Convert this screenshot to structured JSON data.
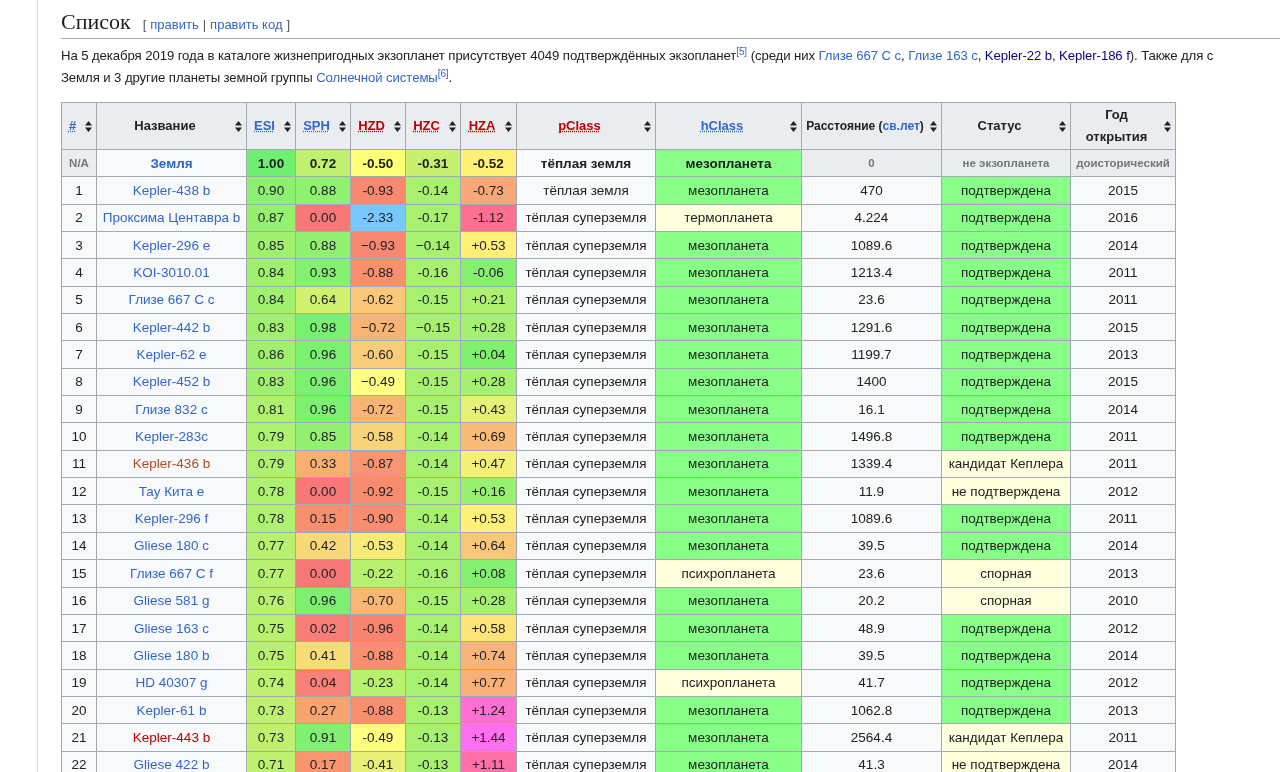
{
  "section": {
    "title": "Список",
    "edit": [
      {
        "kind": "text",
        "text": "["
      },
      {
        "kind": "link",
        "text": "править"
      },
      {
        "kind": "text",
        "text": "|"
      },
      {
        "kind": "link",
        "text": "править код"
      },
      {
        "kind": "text",
        "text": "]"
      }
    ],
    "paragraph": [
      [
        {
          "kind": "text",
          "text": "На 5 декабря 2019 года в каталоге жизнепригодных экзопланет присутствует 4049 подтверждённых экзопланет"
        },
        {
          "kind": "ref",
          "text": "[5]"
        },
        {
          "kind": "text",
          "text": " (среди них "
        },
        {
          "kind": "link",
          "text": "Глизе 667 C c",
          "color": "#3366cc"
        },
        {
          "kind": "text",
          "text": ", "
        },
        {
          "kind": "link",
          "text": "Глизе 163 c",
          "color": "#3366cc"
        },
        {
          "kind": "text",
          "text": ", "
        },
        {
          "kind": "link",
          "text": "Kepler-22 b",
          "color": "#0b0080"
        },
        {
          "kind": "text",
          "text": ", "
        },
        {
          "kind": "link",
          "text": "Kepler-186 f",
          "color": "#0b0080"
        },
        {
          "kind": "text",
          "text": "). Также для с"
        }
      ],
      [
        {
          "kind": "text",
          "text": "Земля и 3 другие планеты земной группы "
        },
        {
          "kind": "link",
          "text": "Солнечной системы",
          "color": "#3366cc"
        },
        {
          "kind": "ref",
          "text": "[6]"
        },
        {
          "kind": "text",
          "text": "."
        }
      ]
    ]
  },
  "table": {
    "columns": [
      {
        "parts": [
          {
            "kind": "link",
            "text": "#"
          }
        ]
      },
      {
        "parts": [
          {
            "kind": "text",
            "text": "Название"
          }
        ]
      },
      {
        "parts": [
          {
            "kind": "link",
            "text": "ESI"
          }
        ]
      },
      {
        "parts": [
          {
            "kind": "link",
            "text": "SPH"
          }
        ]
      },
      {
        "parts": [
          {
            "kind": "redlink",
            "text": "HZD"
          }
        ]
      },
      {
        "parts": [
          {
            "kind": "redlink",
            "text": "HZC"
          }
        ]
      },
      {
        "parts": [
          {
            "kind": "redlink",
            "text": "HZA"
          }
        ]
      },
      {
        "parts": [
          {
            "kind": "redlink",
            "text": "pClass"
          }
        ]
      },
      {
        "parts": [
          {
            "kind": "link",
            "text": "hClass"
          }
        ]
      },
      {
        "parts": [
          {
            "kind": "text",
            "text": "Расстояние ("
          },
          {
            "kind": "link",
            "text": "св.лет"
          },
          {
            "kind": "text",
            "text": ")"
          }
        ]
      },
      {
        "parts": [
          {
            "kind": "text",
            "text": "Статус"
          }
        ]
      },
      {
        "parts": [
          {
            "kind": "text",
            "text": "Год открытия"
          }
        ]
      }
    ],
    "rows": [
      {
        "kind": "reference",
        "cells": [
          {
            "text": "N/A",
            "color": "#eaecf0",
            "muted": true
          },
          {
            "text": "Земля",
            "color": "#3366cc"
          },
          {
            "text": "1.00",
            "color": "#70f070"
          },
          {
            "text": "0.72",
            "color": "#c0f070"
          },
          {
            "text": "-0.50",
            "color": "#ffff78"
          },
          {
            "text": "-0.31",
            "color": "#c8f070"
          },
          {
            "text": "-0.52",
            "color": "#fff078"
          },
          {
            "text": "тёплая земля"
          },
          {
            "text": "мезопланета",
            "color": "#88ff88"
          },
          {
            "text": "0",
            "color": "#eaecf0",
            "muted": true
          },
          {
            "text": "не экзопланета",
            "color": "#eaecf0",
            "muted": true
          },
          {
            "text": "доисторический",
            "color": "#eaecf0",
            "muted": true
          }
        ]
      },
      {
        "kind": "planet",
        "cells": [
          {
            "text": "1"
          },
          {
            "text": "Kepler-438 b",
            "color": "#3366cc"
          },
          {
            "text": "0.90",
            "color": "#8cf070"
          },
          {
            "text": "0.88",
            "color": "#90f070"
          },
          {
            "text": "-0.93",
            "color": "#f88870"
          },
          {
            "text": "-0.14",
            "color": "#a8f070"
          },
          {
            "text": "-0.73",
            "color": "#f8a878"
          },
          {
            "text": "тёплая земля"
          },
          {
            "text": "мезопланета",
            "color": "#88ff88"
          },
          {
            "text": "470"
          },
          {
            "text": "подтверждена",
            "color": "#88ff88"
          },
          {
            "text": "2015"
          }
        ]
      },
      {
        "kind": "planet",
        "cells": [
          {
            "text": "2"
          },
          {
            "text": "Проксима Центавра b",
            "color": "#3366cc"
          },
          {
            "text": "0.87",
            "color": "#96f070"
          },
          {
            "text": "0.00",
            "color": "#f87878"
          },
          {
            "text": "-2.33",
            "color": "#78c8ff"
          },
          {
            "text": "-0.17",
            "color": "#a8f070"
          },
          {
            "text": "-1.12",
            "color": "#ff6f8f"
          },
          {
            "text": "тёплая суперземля"
          },
          {
            "text": "термопланета",
            "color": "#ffffdd"
          },
          {
            "text": "4.224"
          },
          {
            "text": "подтверждена",
            "color": "#88ff88"
          },
          {
            "text": "2016"
          }
        ]
      },
      {
        "kind": "planet",
        "cells": [
          {
            "text": "3"
          },
          {
            "text": "Kepler-296 e",
            "color": "#3366cc"
          },
          {
            "text": "0.85",
            "color": "#a0f070"
          },
          {
            "text": "0.88",
            "color": "#90f070"
          },
          {
            "text": "−0.93",
            "color": "#f88870"
          },
          {
            "text": "−0.14",
            "color": "#a8f070"
          },
          {
            "text": "+0.53",
            "color": "#fff078"
          },
          {
            "text": "тёплая суперземля"
          },
          {
            "text": "мезопланета",
            "color": "#88ff88"
          },
          {
            "text": "1089.6"
          },
          {
            "text": "подтверждена",
            "color": "#88ff88"
          },
          {
            "text": "2014"
          }
        ]
      },
      {
        "kind": "planet",
        "cells": [
          {
            "text": "4"
          },
          {
            "text": "KOI-3010.01",
            "color": "#3366cc"
          },
          {
            "text": "0.84",
            "color": "#a0f070"
          },
          {
            "text": "0.93",
            "color": "#84f070"
          },
          {
            "text": "-0.88",
            "color": "#f89070"
          },
          {
            "text": "-0.16",
            "color": "#a8f070"
          },
          {
            "text": "-0.06",
            "color": "#84f070"
          },
          {
            "text": "тёплая суперземля"
          },
          {
            "text": "мезопланета",
            "color": "#88ff88"
          },
          {
            "text": "1213.4"
          },
          {
            "text": "подтверждена",
            "color": "#88ff88"
          },
          {
            "text": "2011"
          }
        ]
      },
      {
        "kind": "planet",
        "cells": [
          {
            "text": "5"
          },
          {
            "text": "Глизе 667 C c",
            "color": "#3366cc"
          },
          {
            "text": "0.84",
            "color": "#a0f070"
          },
          {
            "text": "0.64",
            "color": "#d0f070"
          },
          {
            "text": "-0.62",
            "color": "#f8c878"
          },
          {
            "text": "-0.15",
            "color": "#a8f070"
          },
          {
            "text": "+0.21",
            "color": "#acf070"
          },
          {
            "text": "тёплая суперземля"
          },
          {
            "text": "мезопланета",
            "color": "#88ff88"
          },
          {
            "text": "23.6"
          },
          {
            "text": "подтверждена",
            "color": "#88ff88"
          },
          {
            "text": "2011"
          }
        ]
      },
      {
        "kind": "planet",
        "cells": [
          {
            "text": "6"
          },
          {
            "text": "Kepler-442 b",
            "color": "#3366cc"
          },
          {
            "text": "0.83",
            "color": "#a0f070"
          },
          {
            "text": "0.98",
            "color": "#78f070"
          },
          {
            "text": "−0.72",
            "color": "#f8b474"
          },
          {
            "text": "−0.15",
            "color": "#a8f070"
          },
          {
            "text": "+0.28",
            "color": "#a4f070"
          },
          {
            "text": "тёплая суперземля"
          },
          {
            "text": "мезопланета",
            "color": "#88ff88"
          },
          {
            "text": "1291.6"
          },
          {
            "text": "подтверждена",
            "color": "#88ff88"
          },
          {
            "text": "2015"
          }
        ]
      },
      {
        "kind": "planet",
        "cells": [
          {
            "text": "7"
          },
          {
            "text": "Kepler-62 e",
            "color": "#3366cc"
          },
          {
            "text": "0.86",
            "color": "#a0f070"
          },
          {
            "text": "0.96",
            "color": "#7cf070"
          },
          {
            "text": "-0.60",
            "color": "#f8cc78"
          },
          {
            "text": "-0.15",
            "color": "#a8f070"
          },
          {
            "text": "+0.04",
            "color": "#80f070"
          },
          {
            "text": "тёплая суперземля"
          },
          {
            "text": "мезопланета",
            "color": "#88ff88"
          },
          {
            "text": "1199.7"
          },
          {
            "text": "подтверждена",
            "color": "#88ff88"
          },
          {
            "text": "2013"
          }
        ]
      },
      {
        "kind": "planet",
        "cells": [
          {
            "text": "8"
          },
          {
            "text": "Kepler-452 b",
            "color": "#3366cc"
          },
          {
            "text": "0.83",
            "color": "#a0f070"
          },
          {
            "text": "0.96",
            "color": "#7cf070"
          },
          {
            "text": "−0.49",
            "color": "#ffff80"
          },
          {
            "text": "-0.15",
            "color": "#a8f070"
          },
          {
            "text": "+0.28",
            "color": "#a4f070"
          },
          {
            "text": "тёплая суперземля"
          },
          {
            "text": "мезопланета",
            "color": "#88ff88"
          },
          {
            "text": "1400"
          },
          {
            "text": "подтверждена",
            "color": "#88ff88"
          },
          {
            "text": "2015"
          }
        ]
      },
      {
        "kind": "planet",
        "cells": [
          {
            "text": "9"
          },
          {
            "text": "Глизе 832 c",
            "color": "#3366cc"
          },
          {
            "text": "0.81",
            "color": "#aef070"
          },
          {
            "text": "0.96",
            "color": "#7cf070"
          },
          {
            "text": "-0.72",
            "color": "#f8b474"
          },
          {
            "text": "-0.15",
            "color": "#a8f070"
          },
          {
            "text": "+0.43",
            "color": "#e4f078"
          },
          {
            "text": "тёплая суперземля"
          },
          {
            "text": "мезопланета",
            "color": "#88ff88"
          },
          {
            "text": "16.1"
          },
          {
            "text": "подтверждена",
            "color": "#88ff88"
          },
          {
            "text": "2014"
          }
        ]
      },
      {
        "kind": "planet",
        "cells": [
          {
            "text": "10"
          },
          {
            "text": "Kepler-283c",
            "color": "#3366cc"
          },
          {
            "text": "0.79",
            "color": "#aef070"
          },
          {
            "text": "0.85",
            "color": "#94f070"
          },
          {
            "text": "-0.58",
            "color": "#f8d478"
          },
          {
            "text": "-0.14",
            "color": "#a8f070"
          },
          {
            "text": "+0.69",
            "color": "#f8bc78"
          },
          {
            "text": "тёплая суперземля"
          },
          {
            "text": "мезопланета",
            "color": "#88ff88"
          },
          {
            "text": "1496.8"
          },
          {
            "text": "подтверждена",
            "color": "#88ff88"
          },
          {
            "text": "2011"
          }
        ]
      },
      {
        "kind": "planet",
        "cells": [
          {
            "text": "11"
          },
          {
            "text": "Kepler-436 b",
            "color": "#b04a20"
          },
          {
            "text": "0.79",
            "color": "#aef070"
          },
          {
            "text": "0.33",
            "color": "#f8b070"
          },
          {
            "text": "-0.87",
            "color": "#f89470"
          },
          {
            "text": "-0.14",
            "color": "#a8f070"
          },
          {
            "text": "+0.47",
            "color": "#f4f078"
          },
          {
            "text": "тёплая суперземля"
          },
          {
            "text": "мезопланета",
            "color": "#88ff88"
          },
          {
            "text": "1339.4"
          },
          {
            "text": "кандидат Кеплера",
            "color": "#ffffdd"
          },
          {
            "text": "2011"
          }
        ]
      },
      {
        "kind": "planet",
        "cells": [
          {
            "text": "12"
          },
          {
            "text": "Тау Кита e",
            "color": "#3366cc"
          },
          {
            "text": "0.78",
            "color": "#aef070"
          },
          {
            "text": "0.00",
            "color": "#f87878"
          },
          {
            "text": "-0.92",
            "color": "#f88c70"
          },
          {
            "text": "-0.15",
            "color": "#a8f070"
          },
          {
            "text": "+0.16",
            "color": "#98f070"
          },
          {
            "text": "тёплая суперземля"
          },
          {
            "text": "мезопланета",
            "color": "#88ff88"
          },
          {
            "text": "11.9"
          },
          {
            "text": "не подтверждена",
            "color": "#ffffdd"
          },
          {
            "text": "2012"
          }
        ]
      },
      {
        "kind": "planet",
        "cells": [
          {
            "text": "13"
          },
          {
            "text": "Kepler-296 f",
            "color": "#3366cc"
          },
          {
            "text": "0.78",
            "color": "#aef070"
          },
          {
            "text": "0.15",
            "color": "#f89070"
          },
          {
            "text": "-0.90",
            "color": "#f88e70"
          },
          {
            "text": "-0.14",
            "color": "#a8f070"
          },
          {
            "text": "+0.53",
            "color": "#fff078"
          },
          {
            "text": "тёплая суперземля"
          },
          {
            "text": "мезопланета",
            "color": "#88ff88"
          },
          {
            "text": "1089.6"
          },
          {
            "text": "подтверждена",
            "color": "#88ff88"
          },
          {
            "text": "2011"
          }
        ]
      },
      {
        "kind": "planet",
        "cells": [
          {
            "text": "14"
          },
          {
            "text": "Gliese 180 c",
            "color": "#3366cc"
          },
          {
            "text": "0.77",
            "color": "#b8f070"
          },
          {
            "text": "0.42",
            "color": "#f8d878"
          },
          {
            "text": "-0.53",
            "color": "#f8ec78"
          },
          {
            "text": "-0.14",
            "color": "#a8f070"
          },
          {
            "text": "+0.64",
            "color": "#f8c878"
          },
          {
            "text": "тёплая суперземля"
          },
          {
            "text": "мезопланета",
            "color": "#88ff88"
          },
          {
            "text": "39.5"
          },
          {
            "text": "подтверждена",
            "color": "#88ff88"
          },
          {
            "text": "2014"
          }
        ]
      },
      {
        "kind": "planet",
        "cells": [
          {
            "text": "15"
          },
          {
            "text": "Глизе 667 C f",
            "color": "#3366cc"
          },
          {
            "text": "0.77",
            "color": "#b8f070"
          },
          {
            "text": "0.00",
            "color": "#f87878"
          },
          {
            "text": "-0.22",
            "color": "#b8f070"
          },
          {
            "text": "-0.16",
            "color": "#a8f070"
          },
          {
            "text": "+0.08",
            "color": "#84f070"
          },
          {
            "text": "тёплая суперземля"
          },
          {
            "text": "психропланета",
            "color": "#ffffdd"
          },
          {
            "text": "23.6"
          },
          {
            "text": "спорная",
            "color": "#ffffdd"
          },
          {
            "text": "2013"
          }
        ]
      },
      {
        "kind": "planet",
        "cells": [
          {
            "text": "16"
          },
          {
            "text": "Gliese 581 g",
            "color": "#3366cc"
          },
          {
            "text": "0.76",
            "color": "#b8f070"
          },
          {
            "text": "0.96",
            "color": "#7cf070"
          },
          {
            "text": "-0.70",
            "color": "#f8b874"
          },
          {
            "text": "-0.15",
            "color": "#a8f070"
          },
          {
            "text": "+0.28",
            "color": "#a4f070"
          },
          {
            "text": "тёплая суперземля"
          },
          {
            "text": "мезопланета",
            "color": "#88ff88"
          },
          {
            "text": "20.2"
          },
          {
            "text": "спорная",
            "color": "#ffffdd"
          },
          {
            "text": "2010"
          }
        ]
      },
      {
        "kind": "planet",
        "cells": [
          {
            "text": "17"
          },
          {
            "text": "Gliese 163 c",
            "color": "#3366cc"
          },
          {
            "text": "0.75",
            "color": "#b8f070"
          },
          {
            "text": "0.02",
            "color": "#f87c78"
          },
          {
            "text": "-0.96",
            "color": "#f88470"
          },
          {
            "text": "-0.14",
            "color": "#a8f070"
          },
          {
            "text": "+0.58",
            "color": "#fce478"
          },
          {
            "text": "тёплая суперземля"
          },
          {
            "text": "мезопланета",
            "color": "#88ff88"
          },
          {
            "text": "48.9"
          },
          {
            "text": "подтверждена",
            "color": "#88ff88"
          },
          {
            "text": "2012"
          }
        ]
      },
      {
        "kind": "planet",
        "cells": [
          {
            "text": "18"
          },
          {
            "text": "Gliese 180 b",
            "color": "#3366cc"
          },
          {
            "text": "0.75",
            "color": "#b8f070"
          },
          {
            "text": "0.41",
            "color": "#f8dc78"
          },
          {
            "text": "-0.88",
            "color": "#f89070"
          },
          {
            "text": "-0.14",
            "color": "#a8f070"
          },
          {
            "text": "+0.74",
            "color": "#f8b478"
          },
          {
            "text": "тёплая суперземля"
          },
          {
            "text": "мезопланета",
            "color": "#88ff88"
          },
          {
            "text": "39.5"
          },
          {
            "text": "подтверждена",
            "color": "#88ff88"
          },
          {
            "text": "2014"
          }
        ]
      },
      {
        "kind": "planet",
        "cells": [
          {
            "text": "19"
          },
          {
            "text": "HD 40307 g",
            "color": "#3366cc"
          },
          {
            "text": "0.74",
            "color": "#c0f070"
          },
          {
            "text": "0.04",
            "color": "#f88078"
          },
          {
            "text": "-0.23",
            "color": "#b8f070"
          },
          {
            "text": "-0.14",
            "color": "#a8f070"
          },
          {
            "text": "+0.77",
            "color": "#f8b078"
          },
          {
            "text": "тёплая суперземля"
          },
          {
            "text": "психропланета",
            "color": "#ffffdd"
          },
          {
            "text": "41.7"
          },
          {
            "text": "подтверждена",
            "color": "#88ff88"
          },
          {
            "text": "2012"
          }
        ]
      },
      {
        "kind": "planet",
        "cells": [
          {
            "text": "20"
          },
          {
            "text": "Kepler-61 b",
            "color": "#3366cc"
          },
          {
            "text": "0.73",
            "color": "#c0f070"
          },
          {
            "text": "0.27",
            "color": "#f8a470"
          },
          {
            "text": "-0.88",
            "color": "#f89070"
          },
          {
            "text": "-0.13",
            "color": "#a8f070"
          },
          {
            "text": "+1.24",
            "color": "#ff70d0"
          },
          {
            "text": "тёплая суперземля"
          },
          {
            "text": "мезопланета",
            "color": "#88ff88"
          },
          {
            "text": "1062.8"
          },
          {
            "text": "подтверждена",
            "color": "#88ff88"
          },
          {
            "text": "2013"
          }
        ]
      },
      {
        "kind": "planet",
        "cells": [
          {
            "text": "21"
          },
          {
            "text": "Kepler-443 b",
            "color": "#ba0000"
          },
          {
            "text": "0.73",
            "color": "#c0f070"
          },
          {
            "text": "0.91",
            "color": "#80f070"
          },
          {
            "text": "-0.49",
            "color": "#ffff80"
          },
          {
            "text": "-0.13",
            "color": "#a8f070"
          },
          {
            "text": "+1.44",
            "color": "#ff70f0"
          },
          {
            "text": "тёплая суперземля"
          },
          {
            "text": "мезопланета",
            "color": "#88ff88"
          },
          {
            "text": "2564.4"
          },
          {
            "text": "кандидат Кеплера",
            "color": "#ffffdd"
          },
          {
            "text": "2011"
          }
        ]
      },
      {
        "kind": "planet",
        "cells": [
          {
            "text": "22"
          },
          {
            "text": "Gliese 422 b",
            "color": "#3366cc"
          },
          {
            "text": "0.71",
            "color": "#c0f070"
          },
          {
            "text": "0.17",
            "color": "#f89470"
          },
          {
            "text": "-0.41",
            "color": "#e8f078"
          },
          {
            "text": "-0.13",
            "color": "#a8f070"
          },
          {
            "text": "+1.11",
            "color": "#ff70a8"
          },
          {
            "text": "тёплая суперземля"
          },
          {
            "text": "мезопланета",
            "color": "#88ff88"
          },
          {
            "text": "41.3"
          },
          {
            "text": "не подтверждена",
            "color": "#ffffdd"
          },
          {
            "text": "2014"
          }
        ]
      }
    ]
  }
}
